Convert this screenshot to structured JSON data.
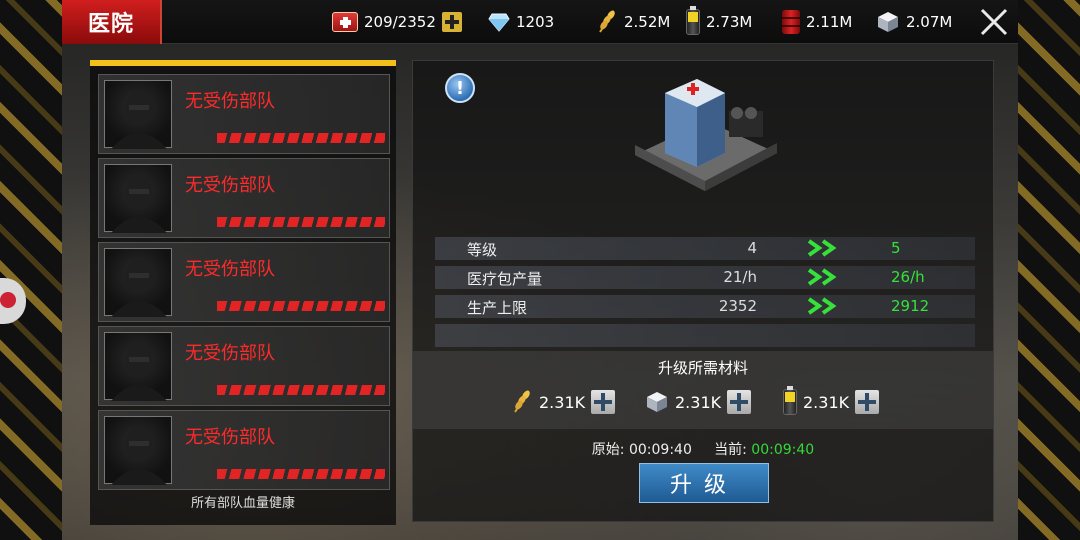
{
  "header": {
    "title": "医院",
    "resources": [
      {
        "icon": "medkit-icon",
        "value": "209/2352"
      },
      {
        "icon": "diamond-icon",
        "value": "1203"
      },
      {
        "icon": "wheat-icon",
        "value": "2.52M"
      },
      {
        "icon": "battery-icon",
        "value": "2.73M"
      },
      {
        "icon": "oil-barrel-icon",
        "value": "2.11M"
      },
      {
        "icon": "steel-cube-icon",
        "value": "2.07M"
      }
    ]
  },
  "wounded": {
    "troops": [
      {
        "name": "无受伤部队",
        "health_fraction": 1.0
      },
      {
        "name": "无受伤部队",
        "health_fraction": 1.0
      },
      {
        "name": "无受伤部队",
        "health_fraction": 1.0
      },
      {
        "name": "无受伤部队",
        "health_fraction": 1.0
      },
      {
        "name": "无受伤部队",
        "health_fraction": 1.0
      }
    ],
    "footer": "所有部队血量健康"
  },
  "upgrade": {
    "info_label": "!",
    "stats": [
      {
        "label": "等级",
        "current": "4",
        "next": "5"
      },
      {
        "label": "医疗包产量",
        "current": "21/h",
        "next": "26/h"
      },
      {
        "label": "生产上限",
        "current": "2352",
        "next": "2912"
      }
    ],
    "materials_title": "升级所需材料",
    "materials": [
      {
        "icon": "wheat-icon",
        "amount": "2.31K"
      },
      {
        "icon": "steel-cube-icon",
        "amount": "2.31K"
      },
      {
        "icon": "battery-icon",
        "amount": "2.31K"
      }
    ],
    "original_label": "原始:",
    "original_time": "00:09:40",
    "current_label": "当前:",
    "current_time": "00:09:40",
    "button_label": "升级"
  },
  "colors": {
    "title_tab": "#d11e1e",
    "warning_stripe": "#c9a43a",
    "left_panel_top": "#f2c01a",
    "troop_name": "#ff2a2a",
    "next_value": "#36e23a",
    "upgrade_button": "#2f74b0"
  }
}
